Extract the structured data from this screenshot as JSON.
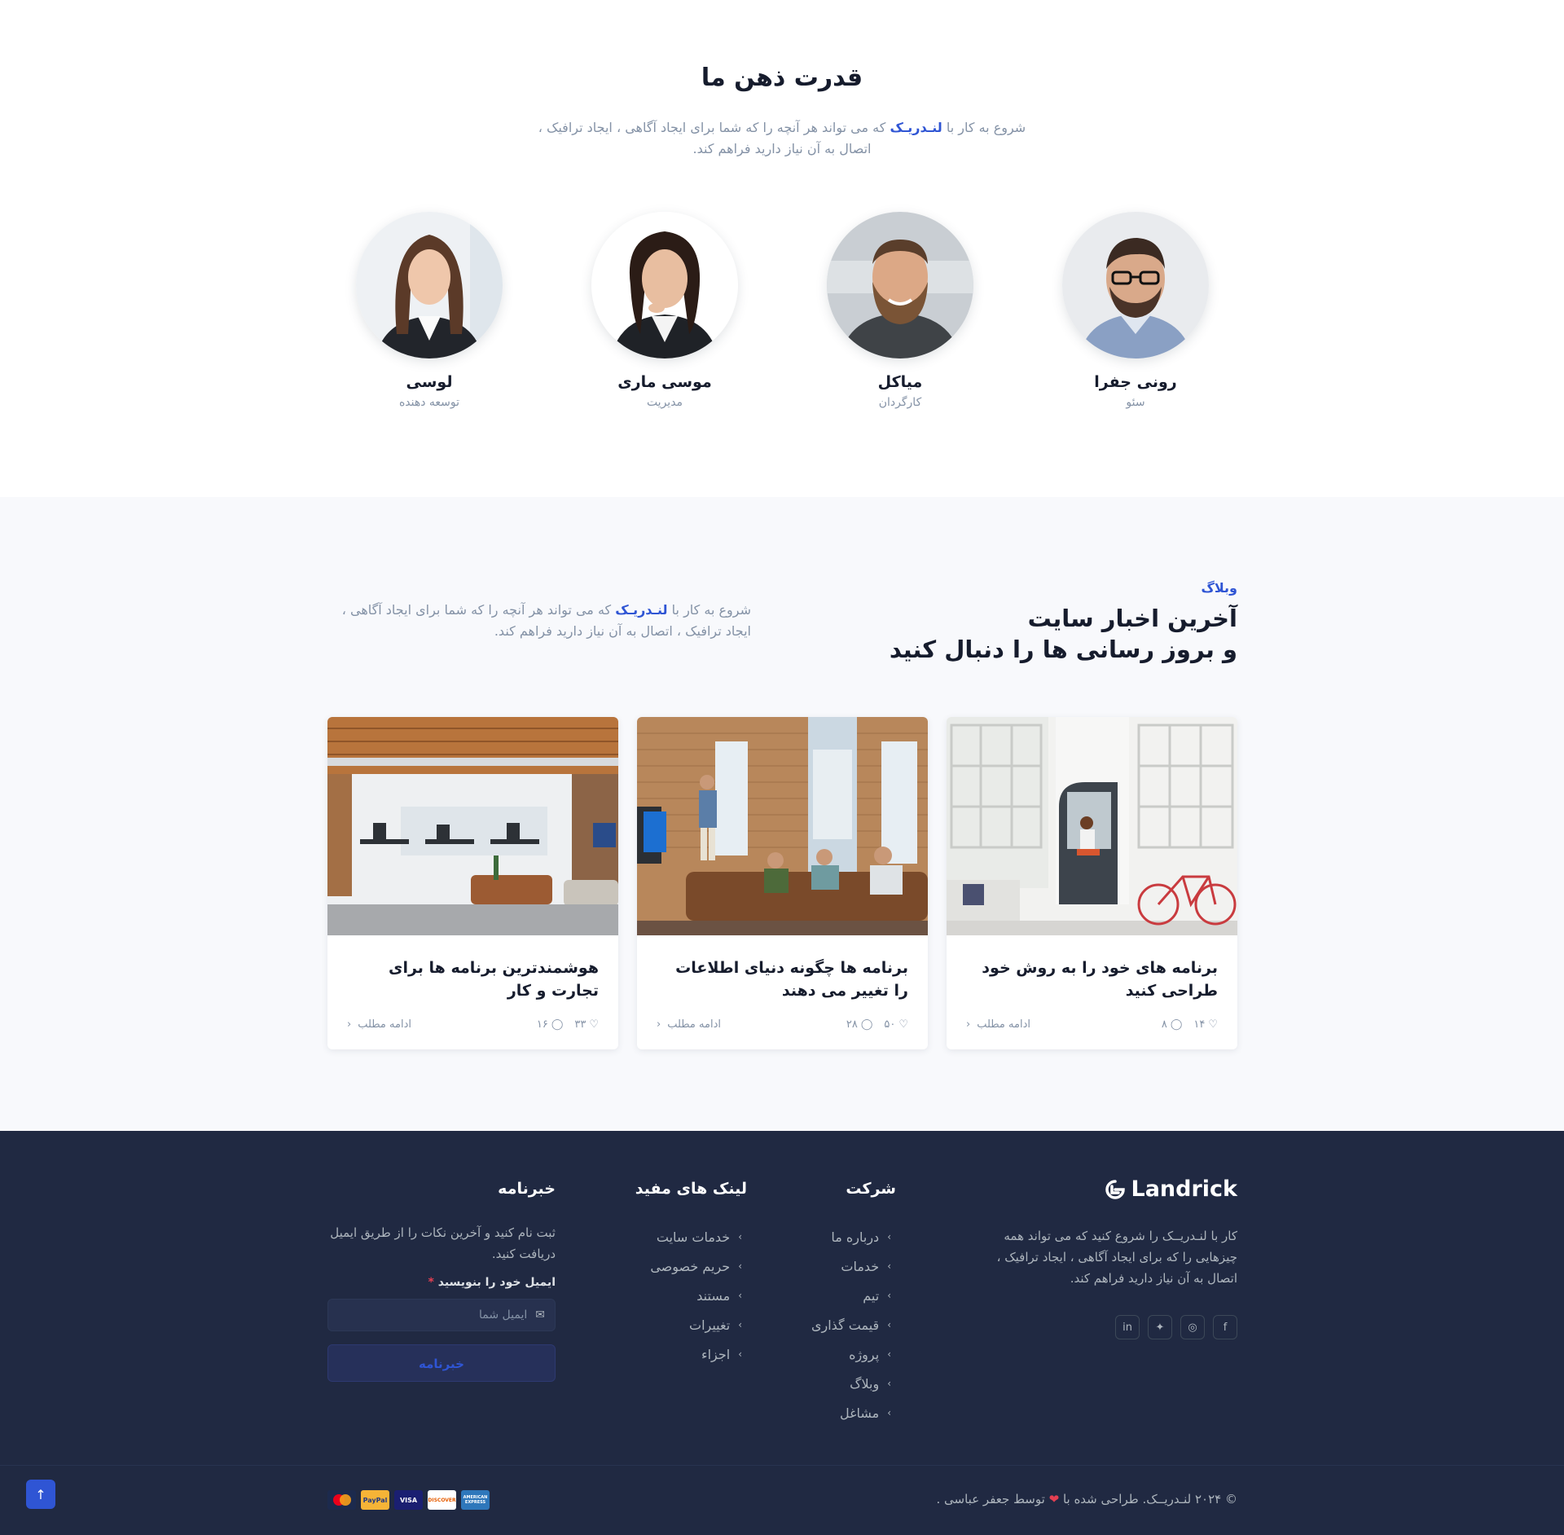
{
  "team": {
    "title": "قدرت ذهن ما",
    "desc_prefix": "شروع به کار با",
    "brand": "لنـدریـک",
    "desc_suffix": "که می تواند هر آنچه را که شما برای ایجاد آگاهی ، ایجاد ترافیک ، اتصال به آن نیاز دارید فراهم کند.",
    "members": [
      {
        "name": "رونی جفرا",
        "role": "سئو"
      },
      {
        "name": "میاکل",
        "role": "کارگردان"
      },
      {
        "name": "موسی ماری",
        "role": "مدیریت"
      },
      {
        "name": "لوسی",
        "role": "توسعه دهنده"
      }
    ]
  },
  "blog": {
    "tag": "وبلاگ",
    "title_line1": "آخرین اخبار سایت",
    "title_line2": "و بروز رسانی ها را دنبال کنید",
    "desc_prefix": "شروع به کار با",
    "brand": "لنـدریـک",
    "desc_suffix": "که می تواند هر آنچه را که شما برای ایجاد آگاهی ، ایجاد ترافیک ، اتصال به آن نیاز دارید فراهم کند.",
    "read_more": "ادامه مطلب",
    "posts": [
      {
        "title": "برنامه های خود را به روش خود طراحی کنید",
        "likes": "۱۴",
        "comments": "۸"
      },
      {
        "title": "برنامه ها چگونه دنیای اطلاعات را تغییر می دهند",
        "likes": "۵۰",
        "comments": "۲۸"
      },
      {
        "title": "هوشمندترین برنامه ها برای تجارت و کار",
        "likes": "۳۳",
        "comments": "۱۶"
      }
    ]
  },
  "footer": {
    "logo_text": "Landrick",
    "about": "کار با لنـدریــک را شروع کنید که می تواند همه چیزهایی را که برای ایجاد آگاهی ، ایجاد ترافیک ، اتصال به آن نیاز دارید فراهم کند.",
    "socials": [
      "facebook-icon",
      "instagram-icon",
      "twitter-icon",
      "linkedin-icon"
    ],
    "company": {
      "title": "شرکت",
      "links": [
        "درباره ما",
        "خدمات",
        "تیم",
        "قیمت گذاری",
        "پروژه",
        "وبلاگ",
        "مشاغل"
      ]
    },
    "useful": {
      "title": "لینک های مفید",
      "links": [
        "خدمات سایت",
        "حریم خصوصی",
        "مستند",
        "تغییرات",
        "اجزاء"
      ]
    },
    "newsletter": {
      "title": "خبرنامه",
      "desc": "ثبت نام کنید و آخرین نکات را از طریق ایمیل دریافت کنید.",
      "label": "ایمیل خود را بنویسید",
      "required": "*",
      "placeholder": "ایمیل شما",
      "button": "خبرنامه"
    },
    "copyright_prefix": "© ۲۰۲۴ لنـدریــک. طراحی شده با",
    "copyright_suffix": "توسط جعفر عباسی .",
    "payments": [
      "MasterCard",
      "PayPal",
      "VISA",
      "DISCOVER",
      "AMERICAN EXPRESS"
    ]
  },
  "colors": {
    "accent": "#2f55d4",
    "footer_bg": "#202942",
    "section_bg": "#f8f9fc",
    "heart": "#e43f52"
  }
}
